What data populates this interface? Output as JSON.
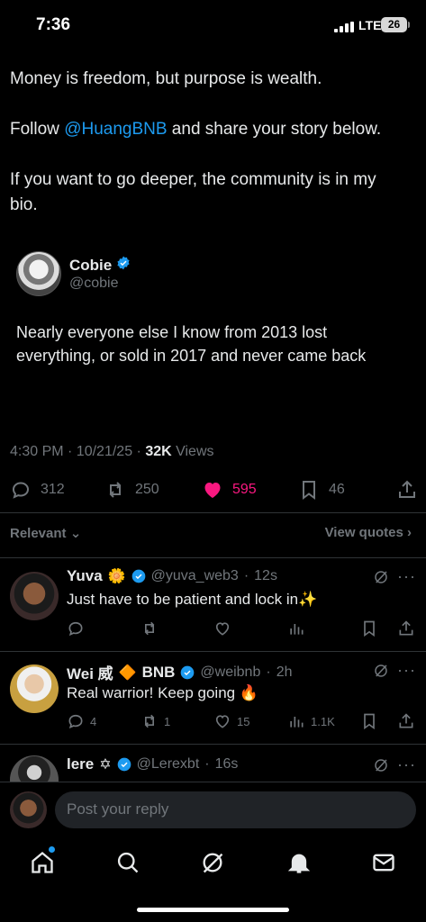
{
  "status_bar": {
    "time": "7:36",
    "network": "LTE",
    "battery": "26"
  },
  "post": {
    "line1": "Money is freedom, but purpose is wealth.",
    "line2_before": "Follow ",
    "line2_mention": "@HuangBNB",
    "line2_after": " and share your story below.",
    "line3a": "If you want to go deeper, the community is in my",
    "line3b": "bio."
  },
  "quote": {
    "name": "Cobie",
    "handle": "@cobie",
    "text_line1": "Nearly everyone else I know from 2013 lost",
    "text_line2": "everything, or sold in 2017 and never came back"
  },
  "meta": {
    "time": "4:30 PM · 10/21/25 · ",
    "views_count": "32K",
    "views_label": " Views"
  },
  "actions": {
    "replies": "312",
    "reposts": "250",
    "likes": "595",
    "bookmarks": "46"
  },
  "filters": {
    "sort": "Relevant",
    "view_quotes": "View quotes"
  },
  "replies": [
    {
      "name": "Yuva",
      "emoji": "🌼",
      "handle": "@yuva_web3",
      "time": "12s",
      "text": "Just have to be patient and lock in✨",
      "replies": "",
      "reposts": "",
      "likes": "",
      "views": ""
    },
    {
      "name": "Wei 威",
      "emoji": "🔶",
      "name2": "BNB",
      "handle": "@weibnb",
      "time": "2h",
      "text": "Real warrior! Keep going 🔥",
      "replies": "4",
      "reposts": "1",
      "likes": "15",
      "views": "1.1K"
    },
    {
      "name": "lere",
      "emoji": "✡",
      "handle": "@Lerexbt",
      "time": "16s",
      "text": ""
    }
  ],
  "compose": {
    "placeholder": "Post your reply"
  },
  "colors": {
    "accent": "#1d9bf0",
    "like": "#f91880",
    "background": "#000000",
    "muted": "#71767b"
  }
}
